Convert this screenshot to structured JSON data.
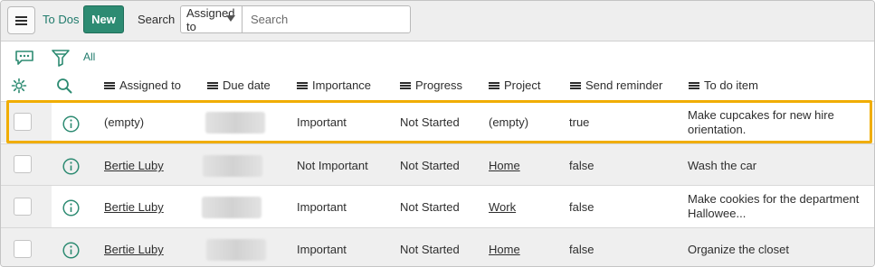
{
  "header": {
    "menu_icon": "hamburger-icon",
    "title": "To Dos",
    "new_label": "New",
    "search_label": "Search",
    "search_field_selected": "Assigned to",
    "search_placeholder": "Search"
  },
  "toolbar": {
    "icons": [
      "chat-icon",
      "filter-icon"
    ],
    "filter_label": "All"
  },
  "columns": [
    {
      "label": "Assigned to"
    },
    {
      "label": "Due date"
    },
    {
      "label": "Importance"
    },
    {
      "label": "Progress"
    },
    {
      "label": "Project"
    },
    {
      "label": "Send reminder"
    },
    {
      "label": "To do item"
    }
  ],
  "rows": [
    {
      "assigned_to": "(empty)",
      "due_date": "",
      "importance": "Important",
      "progress": "Not Started",
      "project": "(empty)",
      "send_reminder": "true",
      "todo_line1": "Make cupcakes for new hire",
      "todo_line2": "orientation.",
      "selected": true
    },
    {
      "assigned_to": "Bertie Luby",
      "due_date": "",
      "importance": "Not Important",
      "progress": "Not Started",
      "project": "Home",
      "send_reminder": "false",
      "todo_line1": "Wash the car",
      "todo_line2": ""
    },
    {
      "assigned_to": "Bertie Luby",
      "due_date": "",
      "importance": "Important",
      "progress": "Not Started",
      "project": "Work",
      "send_reminder": "false",
      "todo_line1": "Make cookies for the department",
      "todo_line2": "Hallowee..."
    },
    {
      "assigned_to": "Bertie Luby",
      "due_date": "",
      "importance": "Important",
      "progress": "Not Started",
      "project": "Home",
      "send_reminder": "false",
      "todo_line1": "Organize the closet",
      "todo_line2": ""
    }
  ],
  "colors": {
    "accent": "#2d8b72",
    "highlight": "#f0ad00"
  }
}
